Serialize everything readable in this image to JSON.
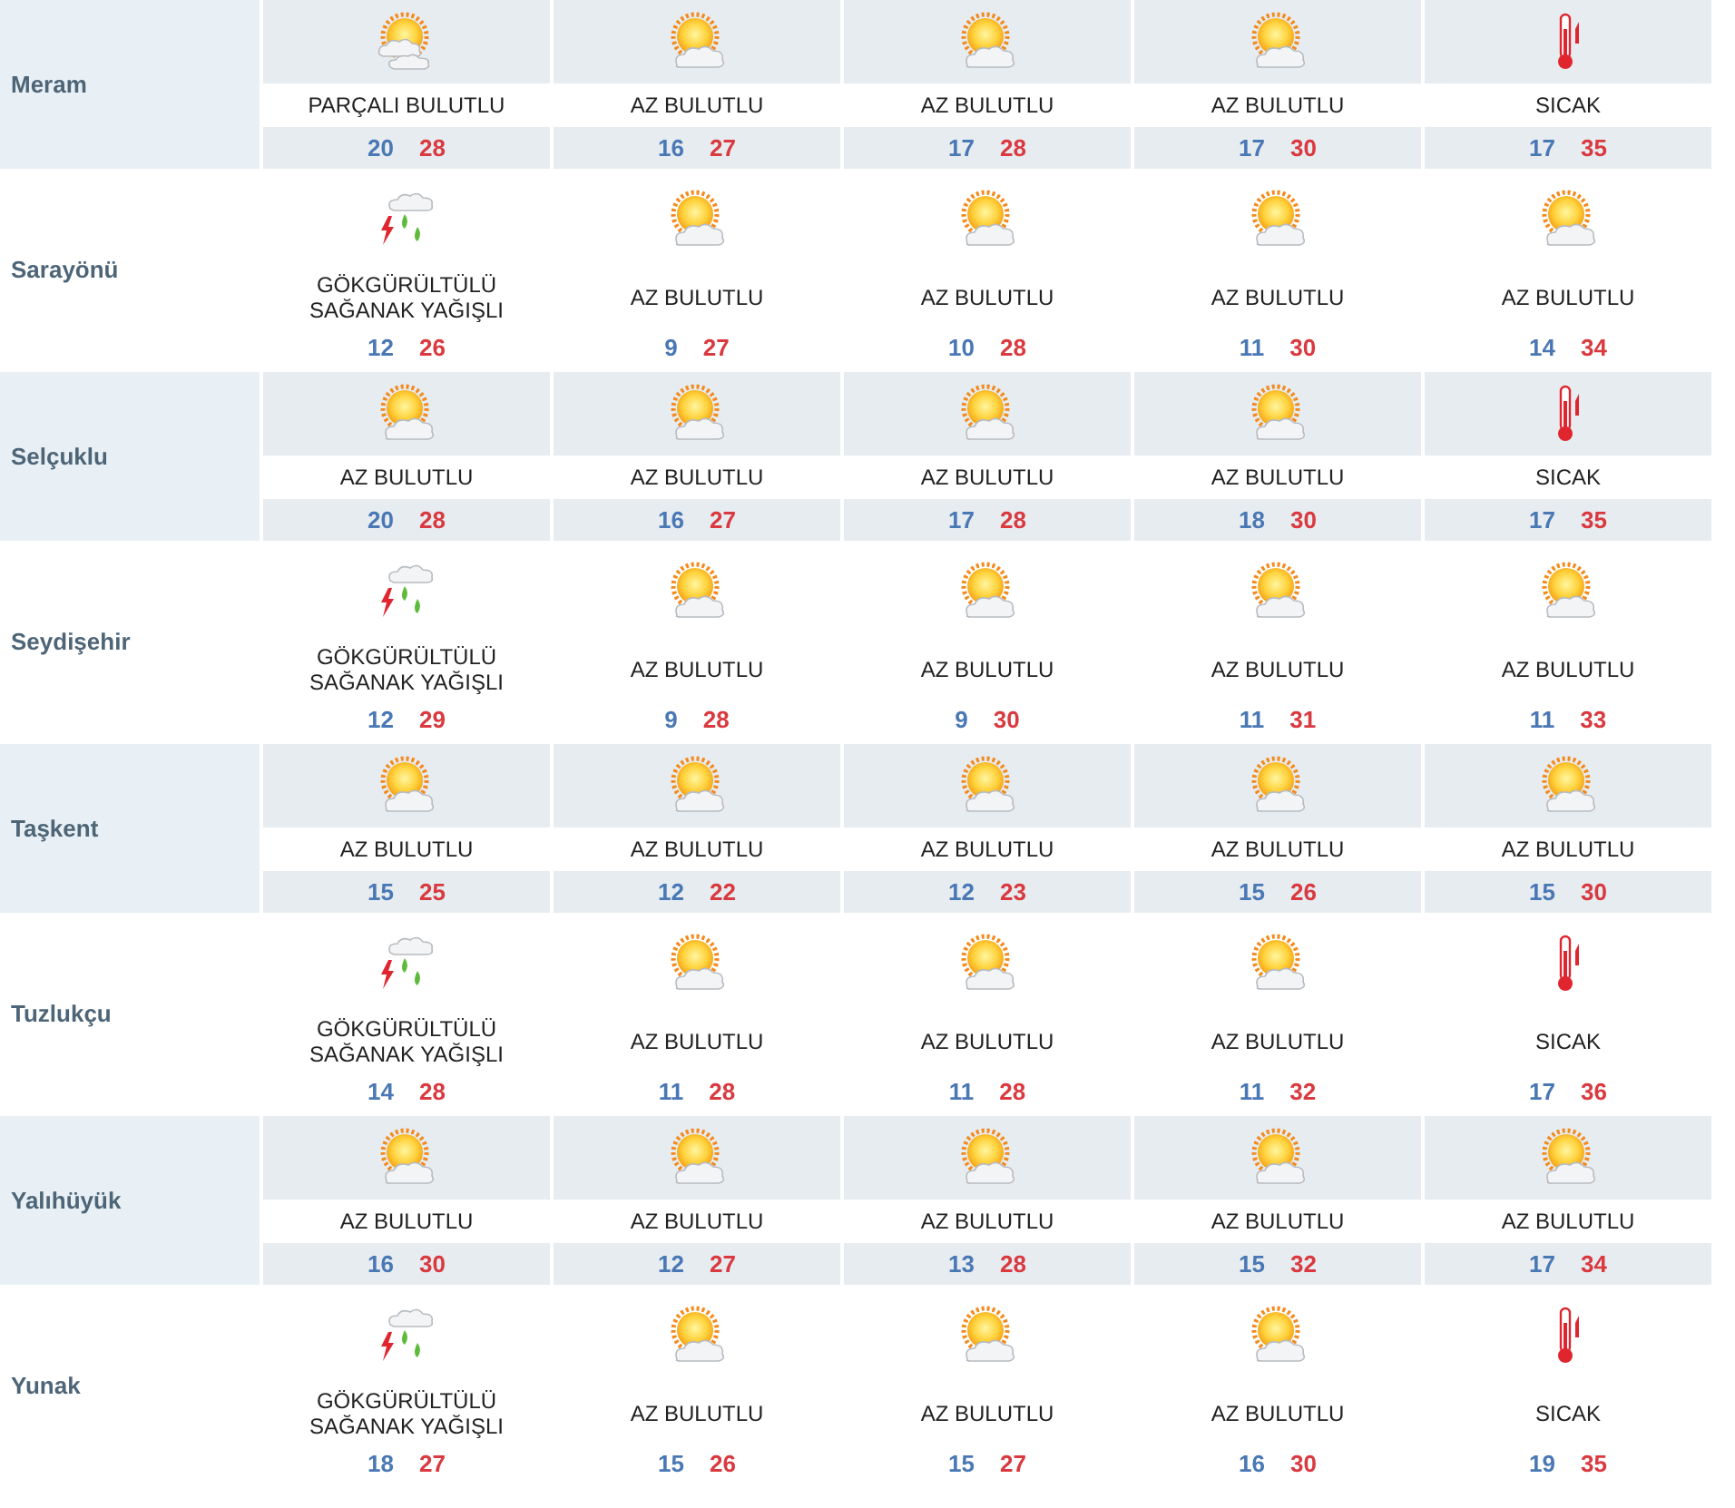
{
  "cities": [
    {
      "name": "Meram",
      "days": [
        {
          "kind": "partly_cloudy",
          "condition": "PARÇALI BULUTLU",
          "low": "20",
          "high": "28"
        },
        {
          "kind": "few_clouds",
          "condition": "AZ BULUTLU",
          "low": "16",
          "high": "27"
        },
        {
          "kind": "few_clouds",
          "condition": "AZ BULUTLU",
          "low": "17",
          "high": "28"
        },
        {
          "kind": "few_clouds",
          "condition": "AZ BULUTLU",
          "low": "17",
          "high": "30"
        },
        {
          "kind": "hot",
          "condition": "SICAK",
          "low": "17",
          "high": "35"
        }
      ]
    },
    {
      "name": "Sarayönü",
      "days": [
        {
          "kind": "thunder",
          "condition": "GÖKGÜRÜLTÜLÜ SAĞANAK YAĞIŞLI",
          "low": "12",
          "high": "26"
        },
        {
          "kind": "few_clouds",
          "condition": "AZ BULUTLU",
          "low": "9",
          "high": "27"
        },
        {
          "kind": "few_clouds",
          "condition": "AZ BULUTLU",
          "low": "10",
          "high": "28"
        },
        {
          "kind": "few_clouds",
          "condition": "AZ BULUTLU",
          "low": "11",
          "high": "30"
        },
        {
          "kind": "few_clouds",
          "condition": "AZ BULUTLU",
          "low": "14",
          "high": "34"
        }
      ]
    },
    {
      "name": "Selçuklu",
      "days": [
        {
          "kind": "few_clouds",
          "condition": "AZ BULUTLU",
          "low": "20",
          "high": "28"
        },
        {
          "kind": "few_clouds",
          "condition": "AZ BULUTLU",
          "low": "16",
          "high": "27"
        },
        {
          "kind": "few_clouds",
          "condition": "AZ BULUTLU",
          "low": "17",
          "high": "28"
        },
        {
          "kind": "few_clouds",
          "condition": "AZ BULUTLU",
          "low": "18",
          "high": "30"
        },
        {
          "kind": "hot",
          "condition": "SICAK",
          "low": "17",
          "high": "35"
        }
      ]
    },
    {
      "name": "Seydişehir",
      "days": [
        {
          "kind": "thunder",
          "condition": "GÖKGÜRÜLTÜLÜ SAĞANAK YAĞIŞLI",
          "low": "12",
          "high": "29"
        },
        {
          "kind": "few_clouds",
          "condition": "AZ BULUTLU",
          "low": "9",
          "high": "28"
        },
        {
          "kind": "few_clouds",
          "condition": "AZ BULUTLU",
          "low": "9",
          "high": "30"
        },
        {
          "kind": "few_clouds",
          "condition": "AZ BULUTLU",
          "low": "11",
          "high": "31"
        },
        {
          "kind": "few_clouds",
          "condition": "AZ BULUTLU",
          "low": "11",
          "high": "33"
        }
      ]
    },
    {
      "name": "Taşkent",
      "days": [
        {
          "kind": "few_clouds",
          "condition": "AZ BULUTLU",
          "low": "15",
          "high": "25"
        },
        {
          "kind": "few_clouds",
          "condition": "AZ BULUTLU",
          "low": "12",
          "high": "22"
        },
        {
          "kind": "few_clouds",
          "condition": "AZ BULUTLU",
          "low": "12",
          "high": "23"
        },
        {
          "kind": "few_clouds",
          "condition": "AZ BULUTLU",
          "low": "15",
          "high": "26"
        },
        {
          "kind": "few_clouds",
          "condition": "AZ BULUTLU",
          "low": "15",
          "high": "30"
        }
      ]
    },
    {
      "name": "Tuzlukçu",
      "days": [
        {
          "kind": "thunder",
          "condition": "GÖKGÜRÜLTÜLÜ SAĞANAK YAĞIŞLI",
          "low": "14",
          "high": "28"
        },
        {
          "kind": "few_clouds",
          "condition": "AZ BULUTLU",
          "low": "11",
          "high": "28"
        },
        {
          "kind": "few_clouds",
          "condition": "AZ BULUTLU",
          "low": "11",
          "high": "28"
        },
        {
          "kind": "few_clouds",
          "condition": "AZ BULUTLU",
          "low": "11",
          "high": "32"
        },
        {
          "kind": "hot",
          "condition": "SICAK",
          "low": "17",
          "high": "36"
        }
      ]
    },
    {
      "name": "Yalıhüyük",
      "days": [
        {
          "kind": "few_clouds",
          "condition": "AZ BULUTLU",
          "low": "16",
          "high": "30"
        },
        {
          "kind": "few_clouds",
          "condition": "AZ BULUTLU",
          "low": "12",
          "high": "27"
        },
        {
          "kind": "few_clouds",
          "condition": "AZ BULUTLU",
          "low": "13",
          "high": "28"
        },
        {
          "kind": "few_clouds",
          "condition": "AZ BULUTLU",
          "low": "15",
          "high": "32"
        },
        {
          "kind": "few_clouds",
          "condition": "AZ BULUTLU",
          "low": "17",
          "high": "34"
        }
      ]
    },
    {
      "name": "Yunak",
      "days": [
        {
          "kind": "thunder",
          "condition": "GÖKGÜRÜLTÜLÜ SAĞANAK YAĞIŞLI",
          "low": "18",
          "high": "27"
        },
        {
          "kind": "few_clouds",
          "condition": "AZ BULUTLU",
          "low": "15",
          "high": "26"
        },
        {
          "kind": "few_clouds",
          "condition": "AZ BULUTLU",
          "low": "15",
          "high": "27"
        },
        {
          "kind": "few_clouds",
          "condition": "AZ BULUTLU",
          "low": "16",
          "high": "30"
        },
        {
          "kind": "hot",
          "condition": "SICAK",
          "low": "19",
          "high": "35"
        }
      ]
    }
  ]
}
